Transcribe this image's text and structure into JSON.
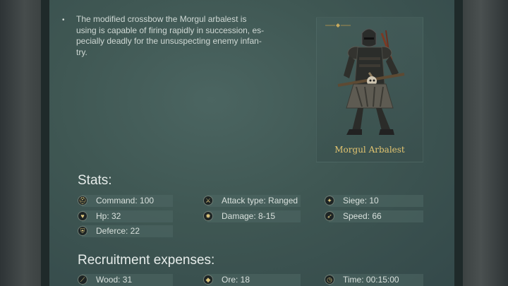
{
  "description": {
    "bullet": "•",
    "lines": [
      "The modified crossbow the Morgul arbalest is",
      "using is capable of firing rapidly in succession, es-",
      "pecially deadly for the unsuspecting enemy infan-",
      "try."
    ]
  },
  "portrait": {
    "unit_name": "Morgul Arbalest"
  },
  "stats": {
    "title": "Stats:",
    "items": [
      {
        "label": "Command: 100",
        "icon": "helmet-icon"
      },
      {
        "label": "Attack type: Ranged",
        "icon": "crossed-swords-icon"
      },
      {
        "label": "Siege: 10",
        "icon": "catapult-icon"
      },
      {
        "label": "Hp: 32",
        "icon": "heart-icon"
      },
      {
        "label": "Damage: 8-15",
        "icon": "burst-icon"
      },
      {
        "label": "Speed: 66",
        "icon": "boot-icon"
      },
      {
        "label": "Deferce: 22",
        "icon": "shield-icon"
      }
    ]
  },
  "expenses": {
    "title": "Recruitment expenses:",
    "items": [
      {
        "label": "Wood: 31",
        "icon": "wood-icon"
      },
      {
        "label": "Ore: 18",
        "icon": "ore-icon"
      },
      {
        "label": "Time: 00:15:00",
        "icon": "clock-icon"
      }
    ]
  },
  "colors": {
    "accent_gold": "#e2c470",
    "panel": "#3f5753"
  }
}
